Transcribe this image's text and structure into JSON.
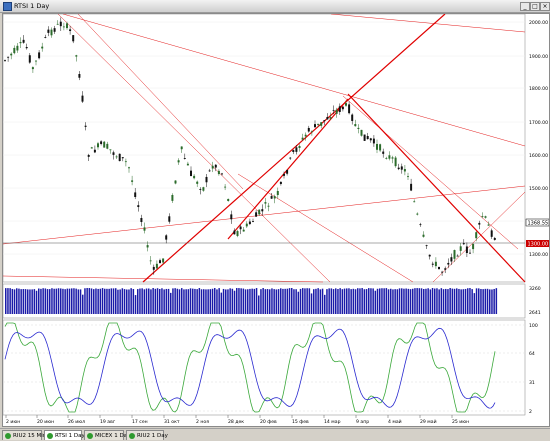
{
  "window": {
    "title": "RTSI 1 Day"
  },
  "colors": {
    "price_up": "#2b6b2b",
    "price_down": "#111111",
    "trend": "#e00000",
    "volume": "#1a1aa8",
    "osc_a": "#2a2ad0",
    "osc_b": "#3aa83a",
    "price_tag": "#cc0000"
  },
  "price_axis": {
    "ticks": [
      "2000.00",
      "1900.00",
      "1800.00",
      "1700.00",
      "1600.00",
      "1500.00",
      "1400.00",
      "1300.00"
    ],
    "current_label": "1368.55",
    "red_label": "1300.00"
  },
  "volume_axis": {
    "ticks": [
      "3260",
      "2641"
    ]
  },
  "osc_axis": {
    "ticks": [
      "100",
      "64",
      "31",
      "2"
    ]
  },
  "time_axis": {
    "labels": [
      "2 июн",
      "20 июн",
      "26 июл",
      "19 авг",
      "17 сен",
      "31 окт",
      "2 ноя",
      "28 дек",
      "20 фев",
      "15 фев",
      "14 мар",
      "9 апр",
      "4 май",
      "29 май",
      "25 июн"
    ]
  },
  "tabs": [
    {
      "label": "RIU2 15 Min",
      "active": false
    },
    {
      "label": "RTSI 1 Day",
      "active": true
    },
    {
      "label": "MICEX 1 Day",
      "active": false
    },
    {
      "label": "RIU2 1 Day",
      "active": false
    }
  ]
}
